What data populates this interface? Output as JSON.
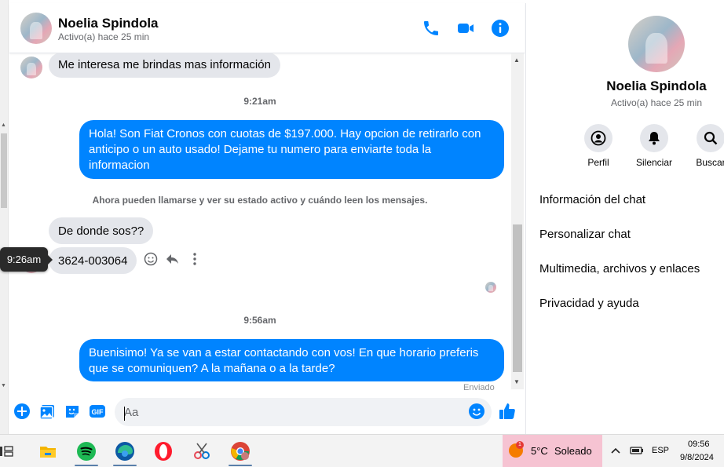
{
  "contact": {
    "name": "Noelia Spindola",
    "status": "Activo(a) hace 25 min"
  },
  "header_icons": [
    "phone-icon",
    "video-icon",
    "info-icon"
  ],
  "messages": {
    "m1": "Me interesa me brindas mas información",
    "ts1": "9:21am",
    "m2": "Hola! Son Fiat Cronos con cuotas de $197.000. Hay opcion de retirarlo con anticipo o un auto usado! Dejame tu numero para enviarte toda la informacion",
    "sys": "Ahora pueden llamarse y ver su estado activo y cuándo leen los mensajes.",
    "m3": "De donde sos??",
    "m4": "3624-003064",
    "tooltip": "9:26am",
    "ts2": "9:56am",
    "m5": "Buenisimo! Ya se van a estar contactando con vos! En que horario preferis que se comuniquen? A la mañana o a la tarde?",
    "sent": "Enviado"
  },
  "composer": {
    "placeholder": "Aa"
  },
  "right_panel": {
    "name": "Noelia Spindola",
    "status": "Activo(a) hace 25 min",
    "buttons": [
      {
        "label": "Perfil",
        "icon": "profile-icon"
      },
      {
        "label": "Silenciar",
        "icon": "bell-icon"
      },
      {
        "label": "Buscar",
        "icon": "search-icon"
      }
    ],
    "items": [
      "Información del chat",
      "Personalizar chat",
      "Multimedia, archivos y enlaces",
      "Privacidad y ayuda"
    ]
  },
  "taskbar": {
    "temperature": "5°C",
    "weather": "Soleado",
    "language": "ESP",
    "time": "09:56",
    "date": "9/8/2024",
    "notification_count": "1"
  },
  "colors": {
    "accent": "#0084ff",
    "incoming_bubble": "#e4e6eb",
    "secondary_text": "#65676b"
  }
}
